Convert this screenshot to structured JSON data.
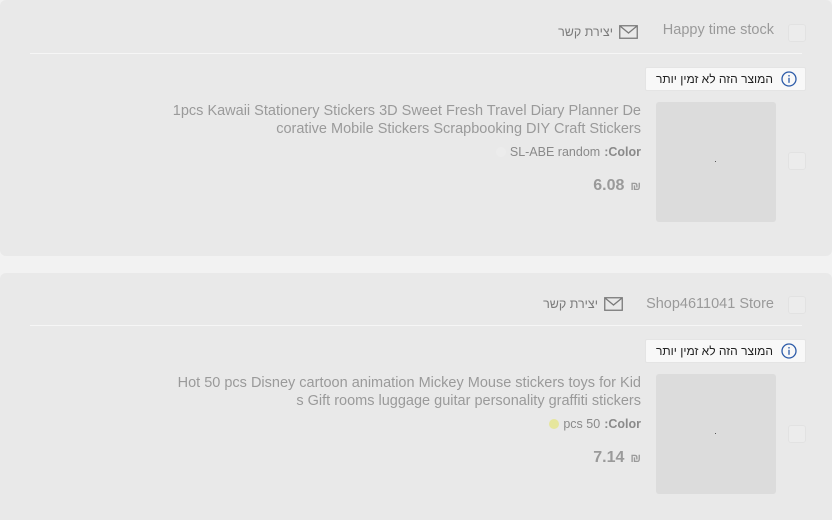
{
  "contact_label": "יצירת קשר",
  "unavailable_label": "המוצר הזה לא זמין יותר",
  "color_label": "Color:",
  "stores": [
    {
      "name": "Happy time stock",
      "product": {
        "title": "1pcs Kawaii Stationery Stickers 3D Sweet Fresh Travel Diary Planner Decorative Mobile Stickers Scrapbooking DIY Craft Stickers",
        "variant_value": "SL-ABE random",
        "swatch_color": "#ececec",
        "currency": "₪",
        "price": "6.08"
      }
    },
    {
      "name": "Shop4611041 Store",
      "product": {
        "title": "Hot 50 pcs Disney cartoon animation Mickey Mouse stickers toys for Kids Gift rooms luggage guitar personality graffiti stickers",
        "variant_value": "50 pcs",
        "swatch_color": "#e6e69c",
        "currency": "₪",
        "price": "7.14"
      }
    }
  ],
  "colors": {
    "card_background": "#e9e9e9",
    "page_background": "#f2f2f2",
    "info_icon": "#2b5aa8",
    "muted_text": "#9a9a9a"
  }
}
